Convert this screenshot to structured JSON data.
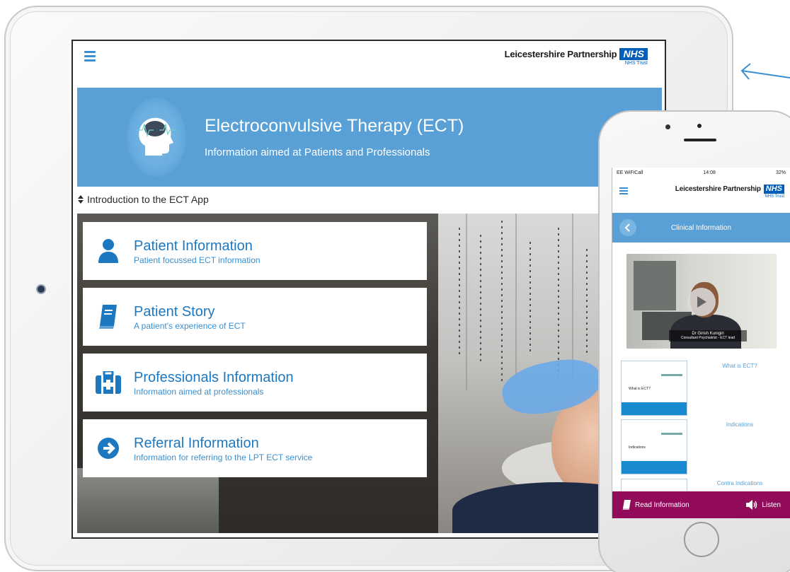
{
  "tablet": {
    "header": {
      "org_name": "Leicestershire Partnership",
      "nhs_badge": "NHS",
      "trust": "NHS Trust"
    },
    "banner": {
      "title": "Electroconvulsive Therapy (ECT)",
      "subtitle": "Information aimed at Patients and Professionals",
      "icon": "head-brain-icon"
    },
    "intro": {
      "label": "Introduction to the ECT App",
      "icon": "sort-arrows-icon"
    },
    "cards": [
      {
        "title": "Patient Information",
        "subtitle": "Patient focussed ECT information",
        "icon": "person-icon"
      },
      {
        "title": "Patient Story",
        "subtitle": "A patient's experience of ECT",
        "icon": "book-icon"
      },
      {
        "title": "Professionals Information",
        "subtitle": "Information aimed at professionals",
        "icon": "medical-kit-icon"
      },
      {
        "title": "Referral Information",
        "subtitle": "Information for referring to the LPT ECT service",
        "icon": "arrow-circle-icon"
      }
    ]
  },
  "phone": {
    "status": {
      "carrier": "EE WiFiCall",
      "time": "14:08",
      "battery": "32%"
    },
    "header": {
      "org_name": "Leicestershire Partnership",
      "nhs_badge": "NHS",
      "trust": "NHS Trust"
    },
    "title_bar": {
      "title": "Clinical Information"
    },
    "video": {
      "caption_name": "Dr Girish Kunigiri",
      "caption_role": "Consultant Psychiatrist - ECT lead"
    },
    "documents": [
      {
        "label": "What is ECT?",
        "thumb_text": "What is ECT?"
      },
      {
        "label": "Indications",
        "thumb_text": "Indications"
      },
      {
        "label": "Contra Indications"
      }
    ],
    "footer": {
      "read_label": "Read Information",
      "listen_label": "Listen"
    }
  },
  "colors": {
    "primary_blue": "#58a0d6",
    "link_blue": "#1c78c0",
    "nhs_blue": "#005eb8",
    "footer_magenta": "#920a5a"
  }
}
